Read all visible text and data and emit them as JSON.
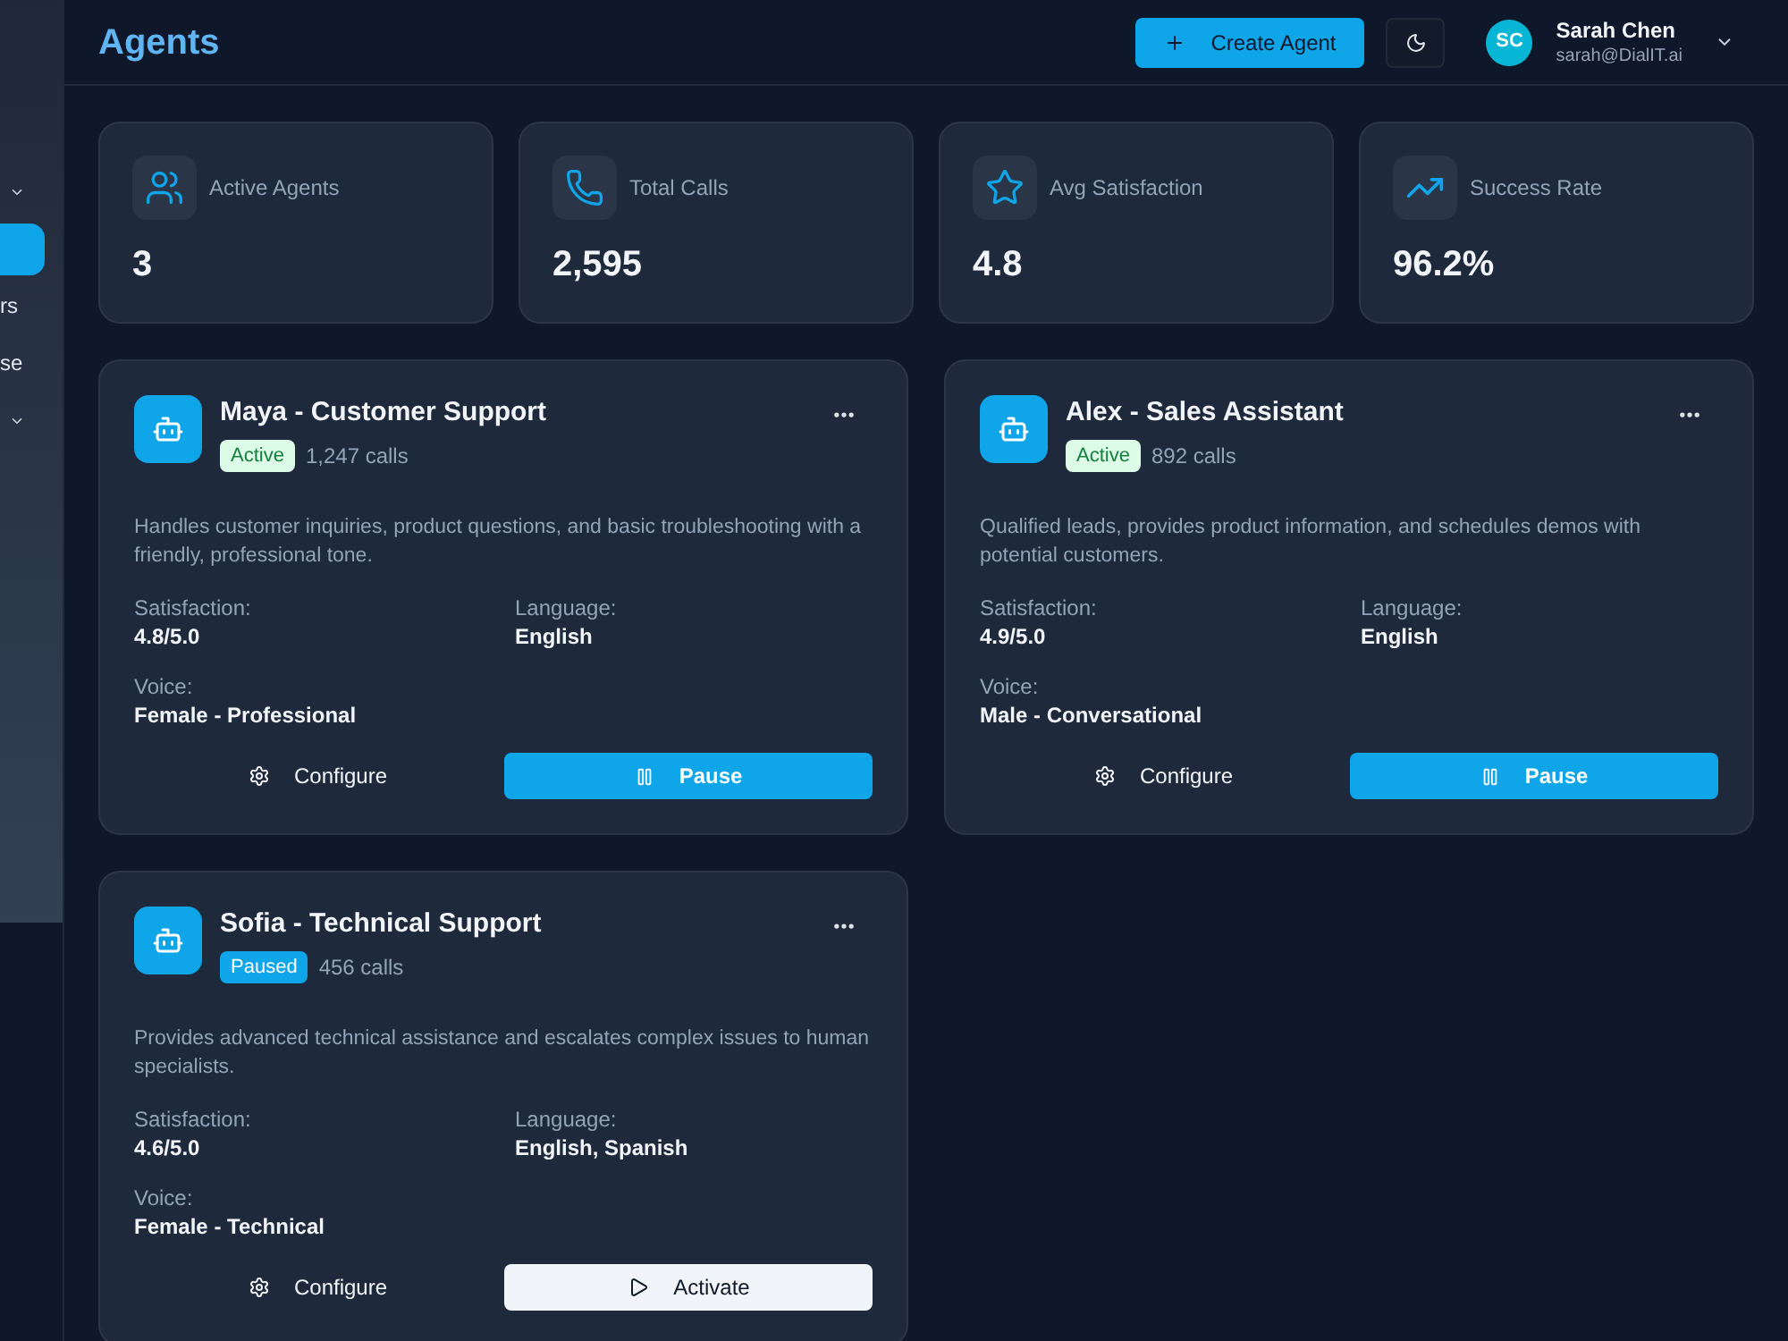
{
  "sidebar": {
    "items": [
      {
        "kind": "group"
      },
      {
        "kind": "link",
        "selected": true
      },
      {
        "kind": "link",
        "label": "rs",
        "selected": false
      },
      {
        "kind": "link",
        "label": "se",
        "selected": false
      },
      {
        "kind": "group"
      }
    ]
  },
  "header": {
    "title": "Agents",
    "create_button": "Create Agent",
    "user": {
      "initials": "SC",
      "name": "Sarah Chen",
      "email": "sarah@DialIT.ai"
    }
  },
  "stats": [
    {
      "kind": "agents",
      "label": "Active Agents",
      "value": "3"
    },
    {
      "kind": "calls",
      "label": "Total Calls",
      "value": "2,595"
    },
    {
      "kind": "satisfaction",
      "label": "Avg Satisfaction",
      "value": "4.8"
    },
    {
      "kind": "success",
      "label": "Success Rate",
      "value": "96.2%"
    }
  ],
  "agents": [
    {
      "name": "Maya - Customer Support",
      "status": {
        "kind": "active",
        "label": "Active"
      },
      "calls": "1,247 calls",
      "description": "Handles customer inquiries, product questions, and basic troubleshooting with a friendly, professional tone.",
      "details": [
        {
          "label": "Satisfaction:",
          "value": "4.8/5.0"
        },
        {
          "label": "Language:",
          "value": "English"
        },
        {
          "label": "Voice:",
          "value": "Female - Professional"
        }
      ],
      "configure": "Configure",
      "action": {
        "kind": "pause",
        "label": "Pause"
      }
    },
    {
      "name": "Alex - Sales Assistant",
      "status": {
        "kind": "active",
        "label": "Active"
      },
      "calls": "892 calls",
      "description": "Qualified leads, provides product information, and schedules demos with potential customers.",
      "details": [
        {
          "label": "Satisfaction:",
          "value": "4.9/5.0"
        },
        {
          "label": "Language:",
          "value": "English"
        },
        {
          "label": "Voice:",
          "value": "Male - Conversational"
        }
      ],
      "configure": "Configure",
      "action": {
        "kind": "pause",
        "label": "Pause"
      }
    },
    {
      "name": "Sofia - Technical Support",
      "status": {
        "kind": "paused",
        "label": "Paused"
      },
      "calls": "456 calls",
      "description": "Provides advanced technical assistance and escalates complex issues to human specialists.",
      "details": [
        {
          "label": "Satisfaction:",
          "value": "4.6/5.0"
        },
        {
          "label": "Language:",
          "value": "English, Spanish"
        },
        {
          "label": "Voice:",
          "value": "Female - Technical"
        }
      ],
      "configure": "Configure",
      "action": {
        "kind": "activate",
        "label": "Activate"
      }
    }
  ]
}
